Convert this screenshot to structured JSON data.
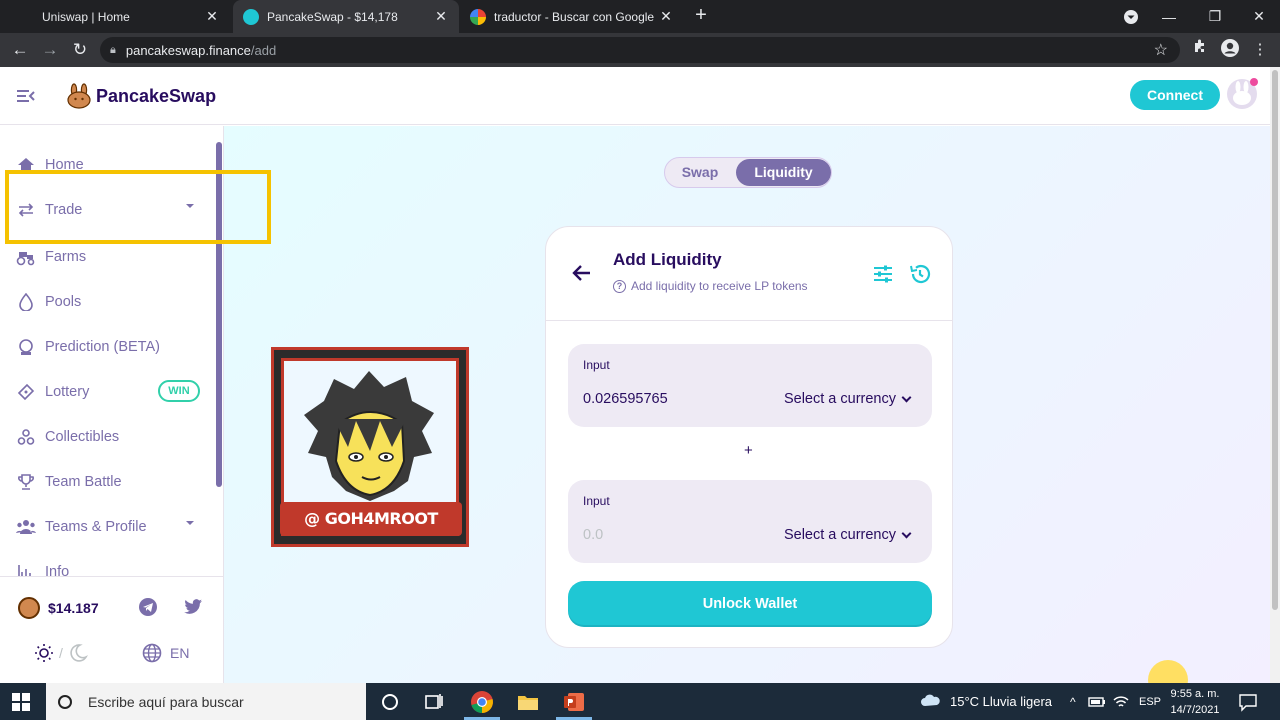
{
  "browser": {
    "tabs": [
      {
        "title": "Uniswap | Home",
        "active": false
      },
      {
        "title": "PancakeSwap - $14,178",
        "active": true
      },
      {
        "title": "traductor - Buscar con Google",
        "active": false
      }
    ],
    "url_host": "pancakeswap.finance",
    "url_path": "/add"
  },
  "header": {
    "brand": "PancakeSwap",
    "connect_label": "Connect"
  },
  "sidebar": {
    "items": [
      {
        "label": "Home",
        "icon": "home-icon"
      },
      {
        "label": "Trade",
        "icon": "trade-icon",
        "chevron": true
      },
      {
        "label": "Farms",
        "icon": "farms-icon"
      },
      {
        "label": "Pools",
        "icon": "pools-icon"
      },
      {
        "label": "Prediction (BETA)",
        "icon": "prediction-icon"
      },
      {
        "label": "Lottery",
        "icon": "lottery-icon",
        "badge": "WIN"
      },
      {
        "label": "Collectibles",
        "icon": "collectibles-icon"
      },
      {
        "label": "Team Battle",
        "icon": "trophy-icon"
      },
      {
        "label": "Teams & Profile",
        "icon": "teams-icon",
        "chevron": true
      },
      {
        "label": "Info",
        "icon": "info-icon"
      }
    ],
    "cake_price": "$14.187",
    "language": "EN"
  },
  "main": {
    "toggle": {
      "swap": "Swap",
      "liquidity": "Liquidity",
      "active": "liquidity"
    },
    "card": {
      "title": "Add Liquidity",
      "subtitle": "Add liquidity to receive LP tokens",
      "input_a": {
        "label": "Input",
        "value": "0.026595765",
        "currency": "Select a currency"
      },
      "plus": "+",
      "input_b": {
        "label": "Input",
        "value": "0.0",
        "currency": "Select a currency"
      },
      "unlock_label": "Unlock Wallet"
    }
  },
  "watermark": {
    "text": "@ GOH4MROOT"
  },
  "taskbar": {
    "search_placeholder": "Escribe aquí para buscar",
    "weather": "15°C  Lluvia ligera",
    "lang": "ESP",
    "time": "9:55 a. m.",
    "date": "14/7/2021"
  },
  "colors": {
    "accent": "#1fc7d4",
    "primary_text": "#280d5f",
    "secondary_text": "#7a6eaa",
    "highlight_box": "#f5c200",
    "success": "#31d0aa"
  }
}
